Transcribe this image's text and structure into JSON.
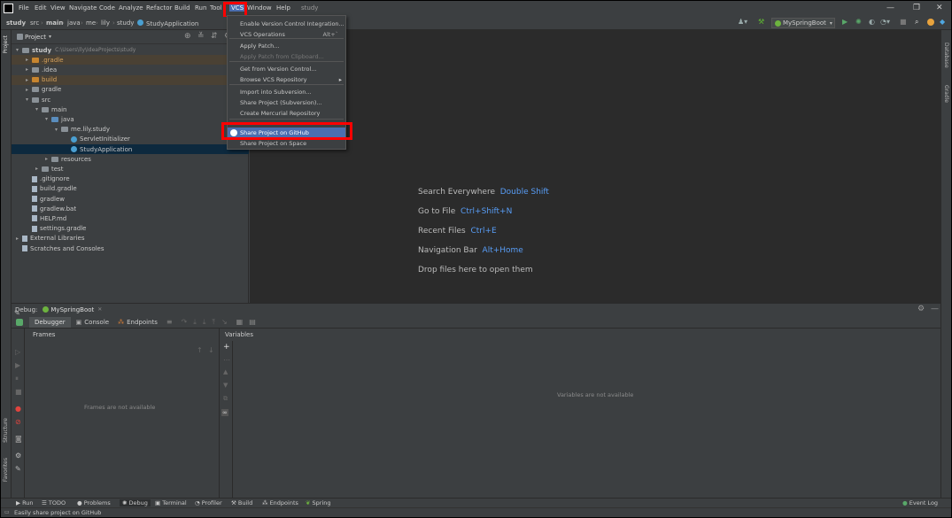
{
  "menu": {
    "app_icon": "intellij-icon",
    "items": [
      "File",
      "Edit",
      "View",
      "Navigate",
      "Code",
      "Analyze",
      "Refactor",
      "Build",
      "Run",
      "Tools",
      "VCS",
      "Window",
      "Help"
    ],
    "tools_visible": "Tool",
    "window_visible": "Window",
    "project_title": "study",
    "window_controls": [
      "—",
      "❐",
      "✕"
    ]
  },
  "navbar": {
    "breadcrumbs": [
      "study",
      "src",
      "main",
      "java",
      "me",
      "lily",
      "study",
      "StudyApplication"
    ],
    "run_config": "MySpringBoot"
  },
  "vcs_menu": {
    "items": [
      {
        "label": "Enable Version Control Integration...",
        "disabled": false
      },
      {
        "label": "VCS Operations",
        "shortcut": "Alt+`",
        "disabled": false
      },
      {
        "label": "Apply Patch...",
        "disabled": false
      },
      {
        "label": "Apply Patch from Clipboard...",
        "disabled": true
      },
      {
        "label": "Get from Version Control...",
        "disabled": false
      },
      {
        "label": "Browse VCS Repository",
        "submenu": true,
        "disabled": false
      },
      {
        "label": "Import into Subversion...",
        "disabled": false
      },
      {
        "label": "Share Project (Subversion)...",
        "disabled": false
      },
      {
        "label": "Create Mercurial Repository",
        "disabled": false
      },
      {
        "label": "Share Project on GitHub",
        "disabled": false,
        "selected": true
      },
      {
        "label": "Share Project on Space",
        "disabled": false
      }
    ]
  },
  "project": {
    "header": "Project",
    "tree": [
      {
        "label": "study",
        "path": "C:\\Users\\lly\\IdeaProjects\\study",
        "kind": "folder-gray",
        "level": 0,
        "arrow": "▾"
      },
      {
        "label": ".gradle",
        "kind": "folder-orange",
        "level": 1,
        "arrow": "▸"
      },
      {
        "label": ".idea",
        "kind": "folder-gray",
        "level": 1,
        "arrow": "▸"
      },
      {
        "label": "build",
        "kind": "folder-orange",
        "level": 1,
        "arrow": "▸"
      },
      {
        "label": "gradle",
        "kind": "folder-gray",
        "level": 1,
        "arrow": "▸"
      },
      {
        "label": "src",
        "kind": "folder-gray",
        "level": 1,
        "arrow": "▾"
      },
      {
        "label": "main",
        "kind": "folder-gray",
        "level": 2,
        "arrow": "▾"
      },
      {
        "label": "java",
        "kind": "folder-blue",
        "level": 3,
        "arrow": "▾"
      },
      {
        "label": "me.lily.study",
        "kind": "folder-gray",
        "level": 4,
        "arrow": "▾"
      },
      {
        "label": "ServletInitializer",
        "kind": "class",
        "level": 5,
        "arrow": ""
      },
      {
        "label": "StudyApplication",
        "kind": "class",
        "level": 5,
        "arrow": ""
      },
      {
        "label": "resources",
        "kind": "folder-gray",
        "level": 3,
        "arrow": "▸"
      },
      {
        "label": "test",
        "kind": "folder-gray",
        "level": 2,
        "arrow": "▸"
      },
      {
        "label": ".gitignore",
        "kind": "file",
        "level": 1,
        "arrow": ""
      },
      {
        "label": "build.gradle",
        "kind": "file",
        "level": 1,
        "arrow": ""
      },
      {
        "label": "gradlew",
        "kind": "file",
        "level": 1,
        "arrow": ""
      },
      {
        "label": "gradlew.bat",
        "kind": "file",
        "level": 1,
        "arrow": ""
      },
      {
        "label": "HELP.md",
        "kind": "file",
        "level": 1,
        "arrow": ""
      },
      {
        "label": "settings.gradle",
        "kind": "file",
        "level": 1,
        "arrow": ""
      },
      {
        "label": "External Libraries",
        "kind": "file",
        "level": 0,
        "arrow": "▸"
      },
      {
        "label": "Scratches and Consoles",
        "kind": "file",
        "level": 0,
        "arrow": ""
      }
    ]
  },
  "editor": {
    "hints": [
      {
        "text": "Search Everywhere",
        "key": "Double Shift"
      },
      {
        "text": "Go to File",
        "key": "Ctrl+Shift+N"
      },
      {
        "text": "Recent Files",
        "key": "Ctrl+E"
      },
      {
        "text": "Navigation Bar",
        "key": "Alt+Home"
      },
      {
        "text": "Drop files here to open them",
        "key": ""
      }
    ]
  },
  "debug": {
    "label": "Debug:",
    "session": "MySpringBoot",
    "tabs": [
      "Debugger",
      "Console",
      "Endpoints"
    ],
    "frames_header": "Frames",
    "frames_empty": "Frames are not available",
    "variables_header": "Variables",
    "variables_empty": "Variables are not available"
  },
  "left_strip": [
    "Project",
    "Structure",
    "Favorites"
  ],
  "right_strip": [
    "Database",
    "Gradle"
  ],
  "bottom_tabs": [
    "Run",
    "TODO",
    "Problems",
    "Debug",
    "Terminal",
    "Profiler",
    "Build",
    "Endpoints",
    "Spring"
  ],
  "event_log": "Event Log",
  "status": "Easily share project on GitHub",
  "colors": {
    "accent": "#4b6eaf",
    "highlight": "#ff0000",
    "key": "#589df6"
  }
}
